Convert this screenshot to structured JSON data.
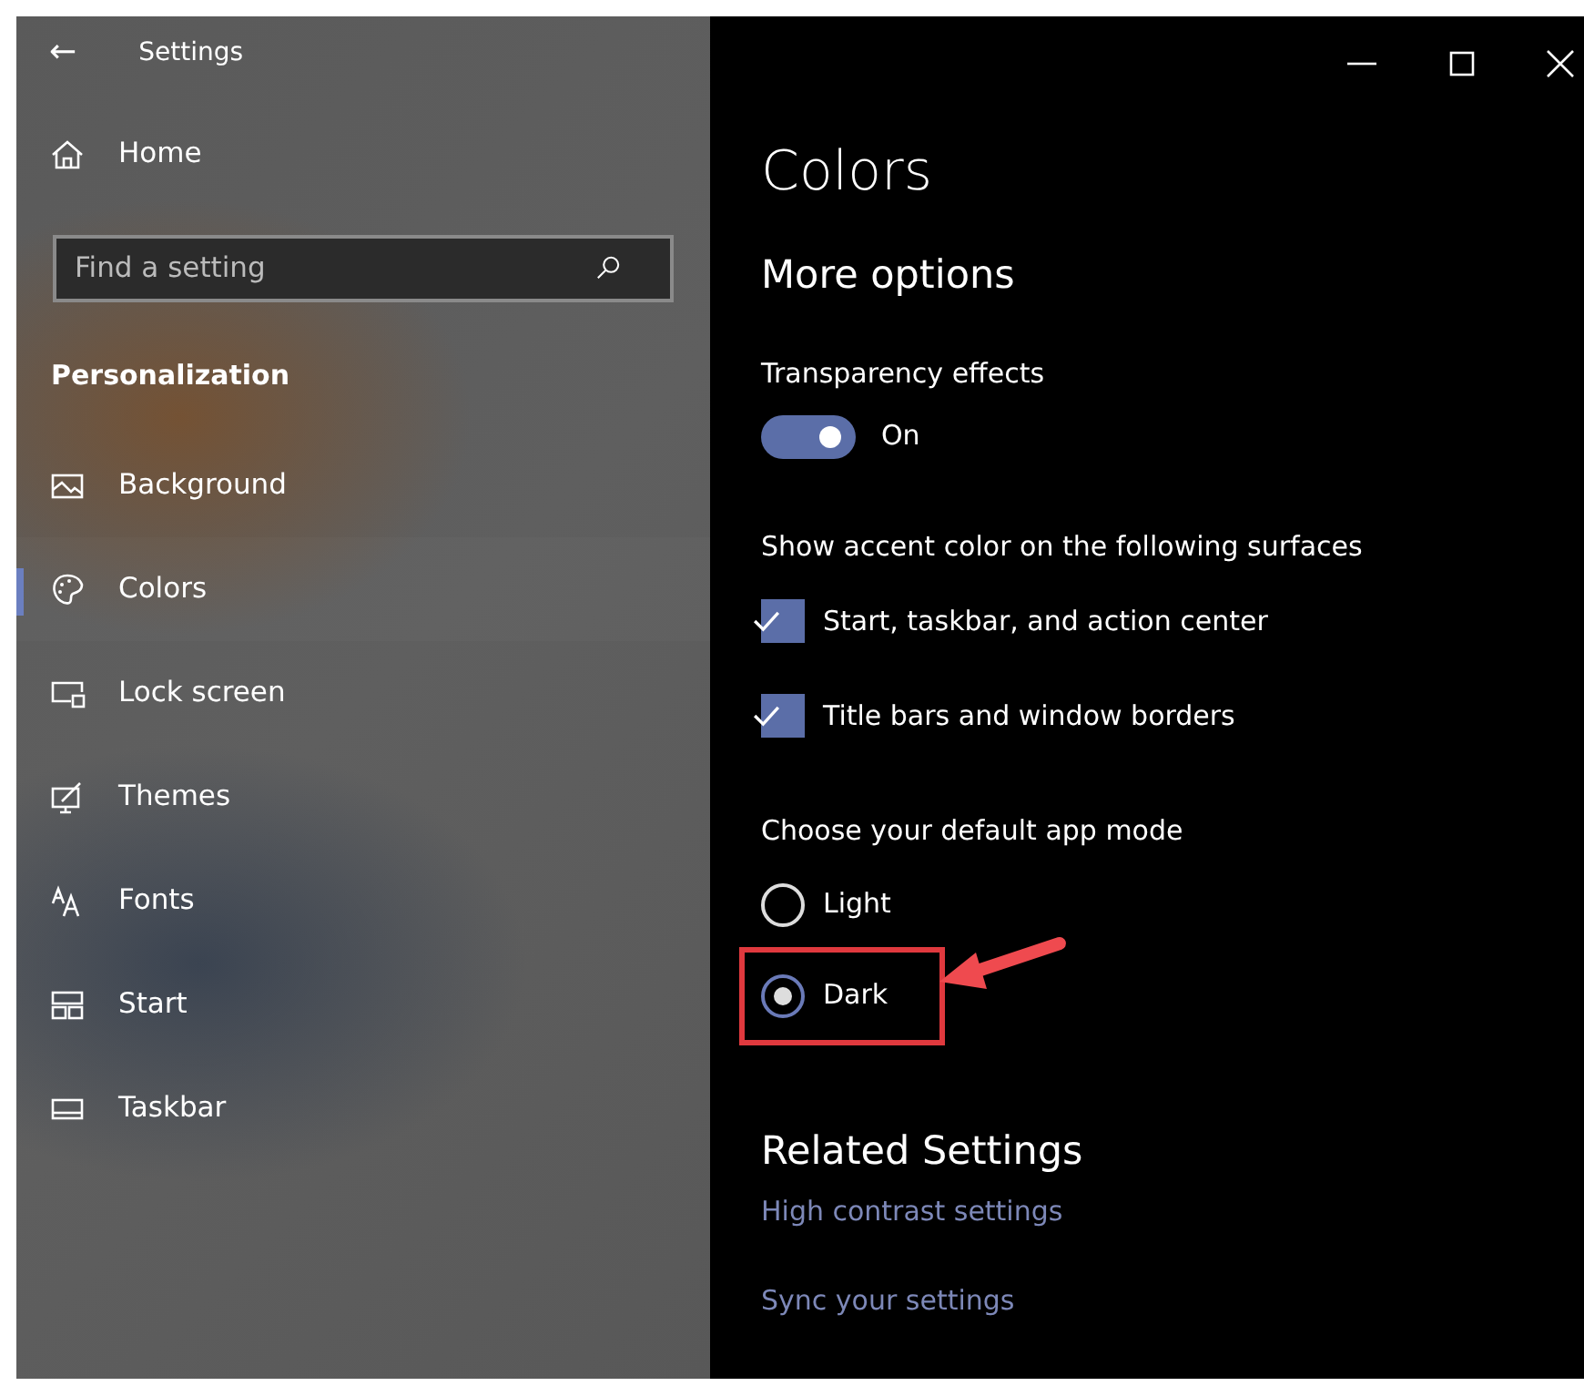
{
  "window": {
    "title": "Settings",
    "back_icon": "←"
  },
  "sidebar": {
    "home": "Home",
    "search": {
      "placeholder": "Find a setting"
    },
    "section": "Personalization",
    "items": [
      {
        "label": "Background",
        "selected": false
      },
      {
        "label": "Colors",
        "selected": true
      },
      {
        "label": "Lock screen",
        "selected": false
      },
      {
        "label": "Themes",
        "selected": false
      },
      {
        "label": "Fonts",
        "selected": false
      },
      {
        "label": "Start",
        "selected": false
      },
      {
        "label": "Taskbar",
        "selected": false
      }
    ]
  },
  "page": {
    "title": "Colors",
    "subtitle": "More options",
    "transparency": {
      "label": "Transparency effects",
      "on": true,
      "state_text": "On"
    },
    "accent_label": "Show accent color on the following surfaces",
    "accent_options": [
      {
        "label": "Start, taskbar, and action center",
        "checked": true
      },
      {
        "label": "Title bars and window borders",
        "checked": true
      }
    ],
    "mode_label": "Choose your default app mode",
    "modes": [
      {
        "label": "Light",
        "selected": false,
        "highlighted": false
      },
      {
        "label": "Dark",
        "selected": true,
        "highlighted": true
      }
    ],
    "related_title": "Related Settings",
    "related_links": [
      "High contrast settings",
      "Sync your settings"
    ]
  }
}
